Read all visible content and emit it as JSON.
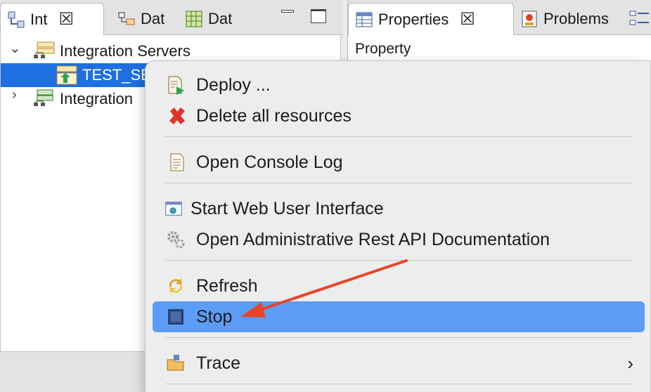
{
  "left_view": {
    "tabs": [
      {
        "label": "Int",
        "icon": "integration-explorer-icon"
      },
      {
        "label": "Dat",
        "icon": "data-source-icon"
      },
      {
        "label": "Dat",
        "icon": "data-design-icon"
      }
    ],
    "close_glyph": "☒",
    "tree": [
      {
        "label": "Integration Servers",
        "expand": "⌄"
      },
      {
        "label": "TEST_SE"
      },
      {
        "label": "Integration",
        "expand": "›"
      }
    ]
  },
  "right_view": {
    "tabs": [
      {
        "label": "Properties",
        "icon": "properties-icon"
      },
      {
        "label": "Problems",
        "icon": "problems-icon"
      }
    ],
    "column_header": "Property"
  },
  "context_menu": {
    "items": [
      {
        "label": "Deploy ...",
        "icon": "deploy-icon"
      },
      {
        "label": "Delete all resources",
        "icon": "delete-icon"
      },
      {
        "label": "Open Console Log",
        "icon": "console-log-icon"
      },
      {
        "label": "Start Web User Interface",
        "icon": "web-ui-icon"
      },
      {
        "label": "Open Administrative Rest API Documentation",
        "icon": "gear-icon"
      },
      {
        "label": "Refresh",
        "icon": "refresh-icon"
      },
      {
        "label": "Stop",
        "icon": "stop-icon",
        "highlighted": true
      },
      {
        "label": "Trace",
        "icon": "folder-icon",
        "submenu_glyph": "›"
      }
    ]
  },
  "colors": {
    "highlight": "#5b9cf6",
    "selection": "#1f6fe0",
    "annotation_arrow": "#e8452c"
  }
}
